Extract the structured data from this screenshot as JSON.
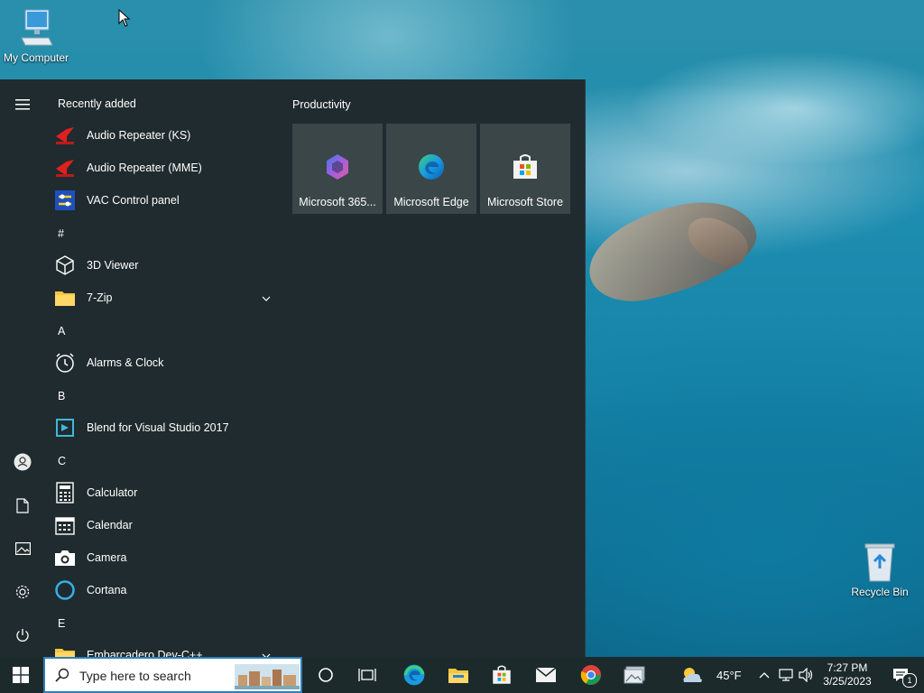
{
  "desktop": {
    "icons": [
      {
        "label": "My Computer"
      },
      {
        "label": "Recycle Bin"
      }
    ]
  },
  "start_menu": {
    "recently_added_label": "Recently added",
    "productivity_label": "Productivity",
    "apps": [
      {
        "label": "Audio Repeater (KS)",
        "icon": "audio-repeater-icon"
      },
      {
        "label": "Audio Repeater (MME)",
        "icon": "audio-repeater-icon"
      },
      {
        "label": "VAC Control panel",
        "icon": "vac-control-icon"
      },
      {
        "header": "#"
      },
      {
        "label": "3D Viewer",
        "icon": "cube-icon"
      },
      {
        "label": "7-Zip",
        "icon": "folder-icon",
        "expandable": true
      },
      {
        "header": "A"
      },
      {
        "label": "Alarms & Clock",
        "icon": "clock-icon"
      },
      {
        "header": "B"
      },
      {
        "label": "Blend for Visual Studio 2017",
        "icon": "blend-icon"
      },
      {
        "header": "C"
      },
      {
        "label": "Calculator",
        "icon": "calculator-icon"
      },
      {
        "label": "Calendar",
        "icon": "calendar-icon"
      },
      {
        "label": "Camera",
        "icon": "camera-icon"
      },
      {
        "label": "Cortana",
        "icon": "cortana-icon"
      },
      {
        "header": "E"
      },
      {
        "label": "Embarcadero Dev-C++",
        "icon": "folder-icon",
        "expandable": true
      }
    ],
    "tiles": [
      {
        "label": "Microsoft 365...",
        "icon": "microsoft-365-icon"
      },
      {
        "label": "Microsoft Edge",
        "icon": "edge-icon"
      },
      {
        "label": "Microsoft Store",
        "icon": "store-icon"
      }
    ]
  },
  "taskbar": {
    "search_placeholder": "Type here to search",
    "weather_temp": "45°F",
    "time": "7:27 PM",
    "date": "3/25/2023",
    "notification_count": "1"
  },
  "colors": {
    "start_bg": "#1f2b2e",
    "tile_bg": "#3a4648",
    "taskbar_bg": "#1c2a2c",
    "search_border": "#2f7fb8"
  }
}
